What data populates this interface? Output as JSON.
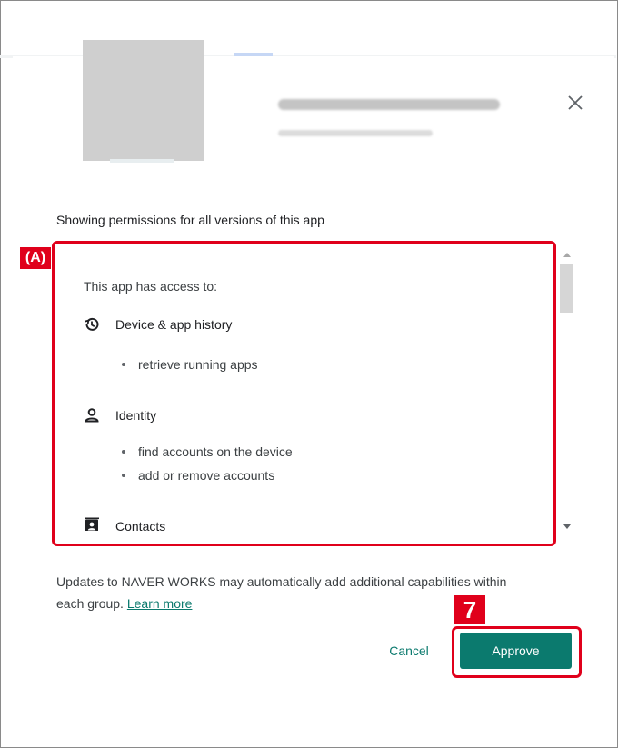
{
  "dialog": {
    "close_icon": "close-icon",
    "showing_text": "Showing permissions for all versions of this app"
  },
  "permissions": {
    "heading": "This app has access to:",
    "groups": [
      {
        "icon": "history-icon",
        "label": "Device & app history",
        "items": [
          "retrieve running apps"
        ]
      },
      {
        "icon": "person-icon",
        "label": "Identity",
        "items": [
          "find accounts on the device",
          "add or remove accounts"
        ]
      },
      {
        "icon": "contacts-icon",
        "label": "Contacts",
        "items": []
      }
    ]
  },
  "annotations": {
    "box_label": "(A)",
    "step_number": "7",
    "color": "#e0001b"
  },
  "footer": {
    "updates_text": "Updates to NAVER WORKS may automatically add additional capabilities within each group.",
    "learn_more": "Learn more",
    "cancel_label": "Cancel",
    "approve_label": "Approve",
    "accent_color": "#0b7a6e"
  }
}
